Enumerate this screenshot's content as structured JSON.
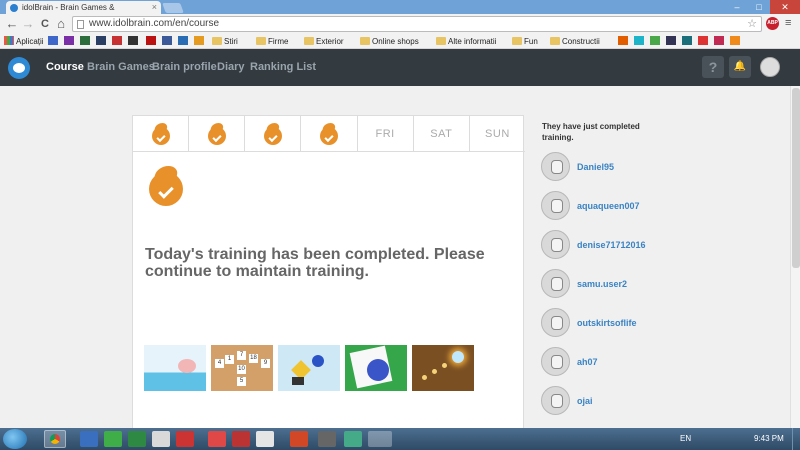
{
  "browser": {
    "tab_title": "idolBrain - Brain Games &",
    "tab_close": "×",
    "url": "www.idolbrain.com/en/course",
    "back": "←",
    "forward": "→",
    "reload": "C",
    "home": "⌂",
    "star": "☆",
    "abp": "ABP",
    "menu": "≡",
    "minimize": "–",
    "maximize": "□",
    "close": "✕"
  },
  "bookmarks": {
    "apps": "Aplicații",
    "items": [
      "Stiri",
      "Firme",
      "Exterior",
      "Online shops",
      "Alte informatii",
      "Fun",
      "Constructii"
    ]
  },
  "site": {
    "nav": [
      "Course",
      "Brain Games",
      "Brain profile",
      "Diary",
      "Ranking List"
    ],
    "help_icon": "?",
    "bell_icon": "🔔"
  },
  "week": {
    "days": [
      {
        "label": "",
        "done": true
      },
      {
        "label": "",
        "done": true
      },
      {
        "label": "",
        "done": true
      },
      {
        "label": "",
        "done": true
      },
      {
        "label": "FRI",
        "done": false
      },
      {
        "label": "SAT",
        "done": false
      },
      {
        "label": "SUN",
        "done": false
      }
    ]
  },
  "main": {
    "message": "Today's training has been completed. Please continue to maintain training."
  },
  "panel": {
    "title": "They have just completed training.",
    "users": [
      "Daniel95",
      "aquaqueen007",
      "denise71712016",
      "samu.user2",
      "outskirtsoflife",
      "ah07",
      "ojai"
    ]
  },
  "taskbar": {
    "lang": "EN",
    "time": "9:43 PM"
  },
  "colors": {
    "accent": "#e8912b",
    "nav_bg": "#333a40",
    "link": "#3a83c4"
  }
}
